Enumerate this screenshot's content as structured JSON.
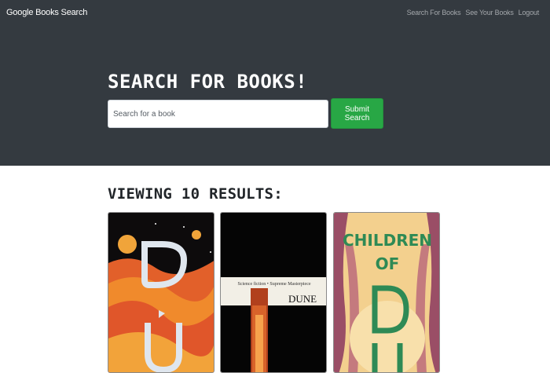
{
  "navbar": {
    "brand": "Google Books Search",
    "links": [
      "Search For Books",
      "See Your Books",
      "Logout"
    ]
  },
  "hero": {
    "title": "Search for Books!",
    "search": {
      "placeholder": "Search for a book",
      "value": ""
    },
    "submit_label": "Submit Search"
  },
  "results": {
    "title": "Viewing 10 results:",
    "books": [
      {
        "cover_text": "DU"
      },
      {
        "cover_text": "DUNE",
        "cover_subtitle": "Science fiction • Supreme Masterpiece"
      },
      {
        "cover_text": "CHILDREN OF D"
      }
    ]
  },
  "colors": {
    "navbar_bg": "#343a40",
    "submit_bg": "#28a745",
    "link": "#a3a7ab"
  }
}
